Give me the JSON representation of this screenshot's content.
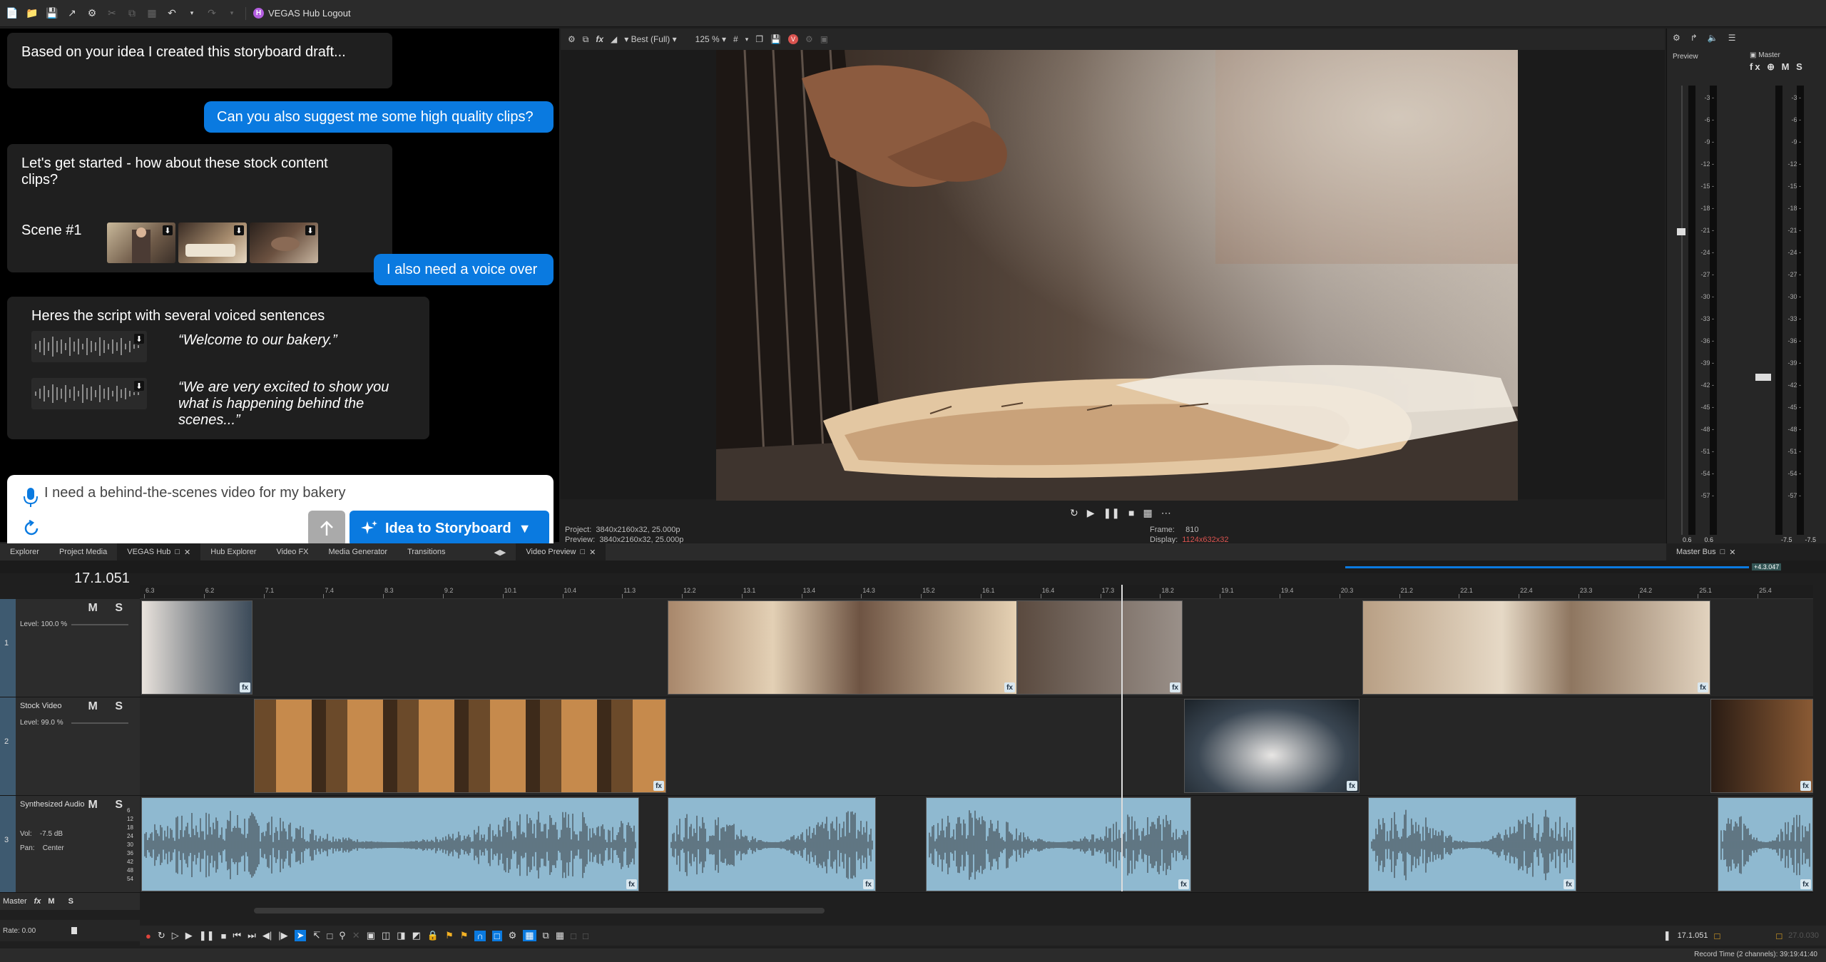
{
  "toolbar": {
    "hub_logout_label": "VEGAS Hub Logout",
    "hub_icon_letter": "H"
  },
  "chat": {
    "messages": [
      {
        "role": "assistant",
        "text": "Based on your idea I created this storyboard draft..."
      },
      {
        "role": "user",
        "text": "Can you also suggest me some high quality clips?"
      },
      {
        "role": "assistant",
        "text": "Let's get started - how about these stock content clips?",
        "scene_label": "Scene #1"
      },
      {
        "role": "user",
        "text": "I also need a voice over"
      },
      {
        "role": "assistant",
        "text": "Heres the script with several voiced sentences",
        "voice_lines": [
          "“Welcome to our bakery.”",
          "“We are very excited to show you what is happening behind the scenes...”"
        ]
      }
    ],
    "input_value": "I need a behind-the-scenes video for my bakery",
    "primary_button_label": "Idea to Storyboard"
  },
  "preview": {
    "quality": "Best (Full)",
    "zoom": "125 %",
    "project_label": "Project:",
    "project_value": "3840x2160x32, 25.000p",
    "preview_label": "Preview:",
    "preview_value": "3840x2160x32, 25.000p",
    "frame_label": "Frame:",
    "frame_value": "810",
    "display_label": "Display:",
    "display_value": "1124x632x32"
  },
  "master_bus": {
    "preview_label": "Preview",
    "master_label": "Master",
    "scale": [
      "3",
      "6",
      "9",
      "12",
      "15",
      "18",
      "21",
      "24",
      "27",
      "30",
      "33",
      "36",
      "39",
      "42",
      "45",
      "48",
      "51",
      "54",
      "57"
    ],
    "left_readout": [
      "0.6",
      "0.6"
    ],
    "right_readout": [
      "-7.5",
      "-7.5"
    ],
    "tab_label": "Master Bus"
  },
  "tabs": [
    "Explorer",
    "Project Media",
    "VEGAS Hub",
    "Hub Explorer",
    "Video FX",
    "Media Generator",
    "Transitions"
  ],
  "preview_tab": "Video Preview",
  "timeline": {
    "timecode": "17.1.051",
    "ruler_labels": [
      "6.3",
      "6.2",
      "7.1",
      "7.4",
      "8.3",
      "9.2",
      "10.1",
      "10.4",
      "11.3",
      "12.2",
      "13.1",
      "13.4",
      "14.3",
      "15.2",
      "16.1",
      "16.4",
      "17.3",
      "18.2",
      "19.1",
      "19.4",
      "20.3",
      "21.2",
      "22.1",
      "22.4",
      "23.3",
      "24.2",
      "25.1",
      "25.4"
    ],
    "selection_label": "+4.3.047",
    "tracks": [
      {
        "num": "1",
        "name": "",
        "level": "Level: 100.0 %"
      },
      {
        "num": "2",
        "name": "Stock Video",
        "level": "Level: 99.0 %"
      },
      {
        "num": "3",
        "name": "Synthesized Audio",
        "vol": "Vol:",
        "vol_value": "-7.5 dB",
        "pan": "Pan:",
        "pan_value": "Center",
        "scale": [
          "6",
          "12",
          "18",
          "24",
          "30",
          "36",
          "42",
          "48",
          "54"
        ]
      }
    ],
    "ms_labels": "M S",
    "master_label": "Master",
    "rate_label": "Rate: 0.00",
    "fx_label": "fx",
    "end_time": "17.1.051",
    "ghost_time": "27.0.030",
    "record_time": "Record Time (2 channels): 39:19:41:40"
  },
  "colors": {
    "accent": "#0a7ae0",
    "audio_clip": "#8fb9d0",
    "track_num": "#3e5a70",
    "display_value": "#d9534f"
  }
}
